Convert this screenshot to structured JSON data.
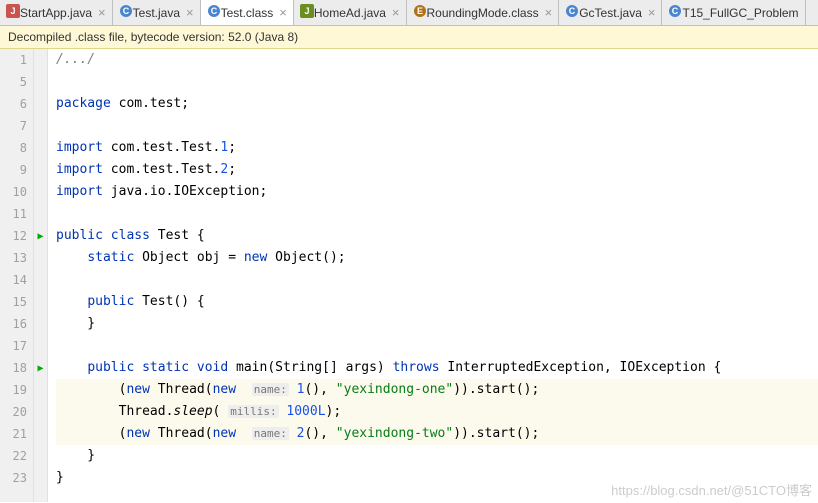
{
  "tabs": [
    {
      "label": "StartApp.java",
      "type": "java-red",
      "active": false
    },
    {
      "label": "Test.java",
      "type": "class",
      "active": false
    },
    {
      "label": "Test.class",
      "type": "class",
      "active": true
    },
    {
      "label": "HomeAd.java",
      "type": "java-pkg",
      "active": false
    },
    {
      "label": "RoundingMode.class",
      "type": "enum",
      "active": false
    },
    {
      "label": "GcTest.java",
      "type": "class",
      "active": false
    },
    {
      "label": "T15_FullGC_Problem",
      "type": "class",
      "active": false
    }
  ],
  "banner": "Decompiled .class file, bytecode version: 52.0 (Java 8)",
  "gutter": [
    "1",
    "5",
    "6",
    "7",
    "8",
    "9",
    "10",
    "11",
    "12",
    "13",
    "14",
    "15",
    "16",
    "17",
    "18",
    "19",
    "20",
    "21",
    "22",
    "23"
  ],
  "run_markers": {
    "12": true,
    "18": true
  },
  "code": {
    "l1": "/.../",
    "l6": "package com.test;",
    "l8": "import com.test.Test.1;",
    "l9": "import com.test.Test.2;",
    "l10": "import java.io.IOException;",
    "l12": "public class Test {",
    "l13_a": "    static Object obj = ",
    "l13_b": "new",
    "l13_c": " Object();",
    "l15": "    public Test() {",
    "l16": "    }",
    "l18": "    public static void main(String[] args) throws InterruptedException, IOException {",
    "l19_a": "        (",
    "l19_b": "new",
    "l19_c": " Thread(",
    "l19_d": "new",
    "l19_hint1": "name:",
    "l19_e": " 1(), ",
    "l19_str": "\"yexindong-one\"",
    "l19_f": ")).start();",
    "l20_a": "        Thread.sleep(",
    "l20_hint": "millis:",
    "l20_num": " 1000L",
    "l20_b": ");",
    "l21_a": "        (",
    "l21_b": "new",
    "l21_c": " Thread(",
    "l21_d": "new",
    "l21_hint1": "name:",
    "l21_e": " 2(), ",
    "l21_str": "\"yexindong-two\"",
    "l21_f": ")).start();",
    "l22": "    }",
    "l23": "}"
  },
  "watermark": "https://blog.csdn.net/@51CTO博客"
}
